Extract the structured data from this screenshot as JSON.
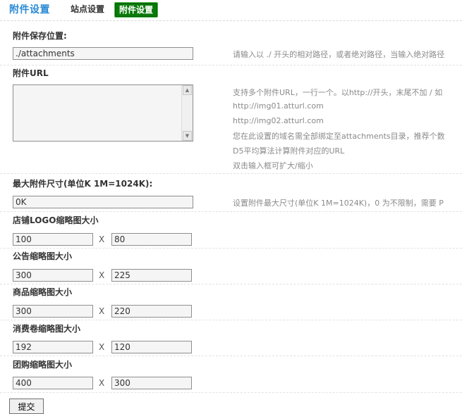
{
  "header": {
    "title": "附件设置",
    "tabs": [
      {
        "label": "站点设置",
        "active": false
      },
      {
        "label": "附件设置",
        "active": true
      }
    ]
  },
  "fields": {
    "save_path": {
      "label": "附件保存位置:",
      "value": "./attachments",
      "hint": "请输入以 ./ 开头的相对路径，或者绝对路径，当输入绝对路径"
    },
    "url": {
      "label": "附件URL",
      "value": "",
      "hints": [
        "支持多个附件URL，一行一个。以http://开头，末尾不加 / 如",
        "http://img01.atturl.com",
        "http://img02.atturl.com",
        "您在此设置的域名需全部绑定至attachments目录，推荐个数",
        "D5平均算法计算附件对应的URL",
        "双击输入框可扩大/缩小"
      ]
    },
    "max_size": {
      "label": "最大附件尺寸(单位K 1M=1024K):",
      "value": "0K",
      "hint": "设置附件最大尺寸(单位K 1M=1024K)，0 为不限制，需要 P"
    },
    "shop_logo": {
      "label": "店铺LOGO缩略图大小",
      "width": "100",
      "height": "80"
    },
    "notice": {
      "label": "公告缩略图大小",
      "width": "300",
      "height": "225"
    },
    "goods": {
      "label": "商品缩略图大小",
      "width": "300",
      "height": "220"
    },
    "coupon": {
      "label": "消费卷缩略图大小",
      "width": "192",
      "height": "120"
    },
    "groupbuy": {
      "label": "团购缩略图大小",
      "width": "400",
      "height": "300"
    },
    "separator": "X"
  },
  "submit_label": "提交"
}
